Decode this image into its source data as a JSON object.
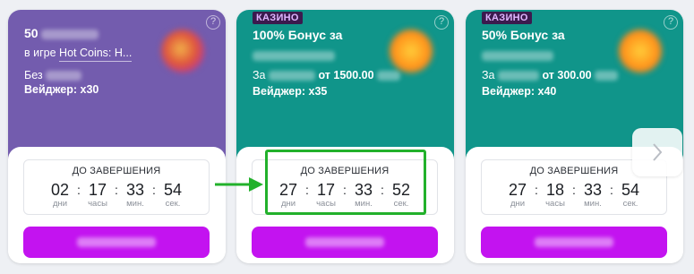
{
  "cards": [
    {
      "badge": "",
      "title": "50",
      "line1_prefix": "в игре",
      "line1_link": "Hot Coins: H...",
      "line2_prefix": "Без",
      "line2_bold": "",
      "wager_label": "Вейджер:",
      "wager_value": "x30",
      "timer_label": "ДО ЗАВЕРШЕНИЯ",
      "days": "02",
      "hours": "17",
      "minutes": "33",
      "seconds": "54",
      "thumb_icon": "game-thumbnail-icon"
    },
    {
      "badge": "КАЗИНО",
      "title": "100% Бонус за",
      "line1_prefix": "",
      "line1_link": "",
      "line2_prefix": "За",
      "line2_bold": "от 1500.00",
      "wager_label": "Вейджер:",
      "wager_value": "x35",
      "timer_label": "ДО ЗАВЕРШЕНИЯ",
      "days": "27",
      "hours": "17",
      "minutes": "33",
      "seconds": "52",
      "thumb_icon": "coin-icon"
    },
    {
      "badge": "КАЗИНО",
      "title": "50% Бонус за",
      "line1_prefix": "",
      "line1_link": "",
      "line2_prefix": "За",
      "line2_bold": "от 300.00",
      "wager_label": "Вейджер:",
      "wager_value": "x40",
      "timer_label": "ДО ЗАВЕРШЕНИЯ",
      "days": "27",
      "hours": "18",
      "minutes": "33",
      "seconds": "54",
      "thumb_icon": "coin-icon"
    }
  ],
  "unit_labels": {
    "days": "дни",
    "hours": "часы",
    "minutes": "мин.",
    "seconds": "сек."
  },
  "separator": ":",
  "help_icon": "?",
  "next_icon": "chevron-right-icon",
  "colors": {
    "purple": "#735cae",
    "teal": "#10958a",
    "cta": "#c313f0",
    "highlight": "#22b12b",
    "badge_bg": "#3b1a4e"
  }
}
